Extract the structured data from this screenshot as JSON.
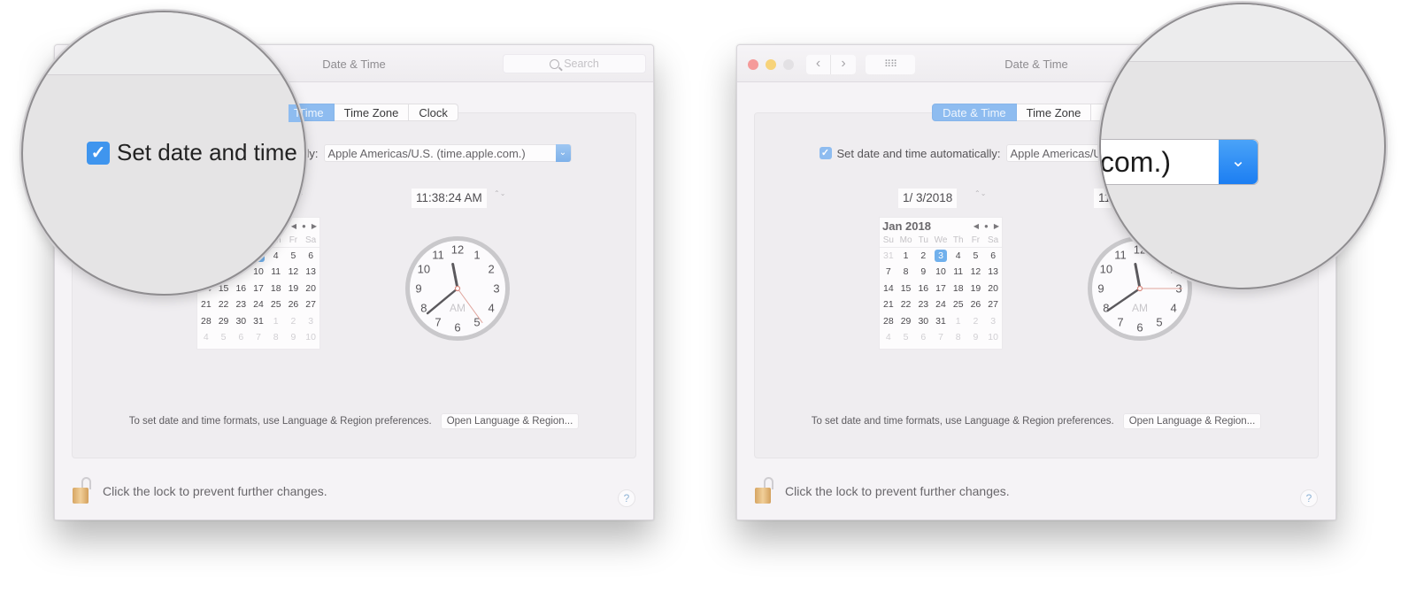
{
  "window": {
    "title": "Date & Time",
    "search_placeholder": "Search",
    "nav_back": "‹",
    "nav_forward": "›",
    "grid_icon": "⠿⠿"
  },
  "tabs": [
    {
      "label": "Date & Time",
      "active": true
    },
    {
      "label": "Time Zone",
      "active": false
    },
    {
      "label": "Clock",
      "active": false
    }
  ],
  "auto_time": {
    "checked": true,
    "check_glyph": "✓",
    "label": "Set date and time automatically:",
    "server": "Apple Americas/U.S. (time.apple.com.)",
    "arrow_glyph": "⌄"
  },
  "date_field": {
    "value": "1/  3/2018",
    "stepper": "⌃⌄"
  },
  "time_field": {
    "value": "11:38:24 AM"
  },
  "calendar": {
    "month_label": "Jan 2018",
    "nav_prev": "◀",
    "nav_today": "●",
    "nav_next": "▶",
    "weekdays": [
      "Su",
      "Mo",
      "Tu",
      "We",
      "Th",
      "Fr",
      "Sa"
    ],
    "selected_day": 3,
    "days": [
      {
        "d": "31",
        "other": true
      },
      {
        "d": "1"
      },
      {
        "d": "2"
      },
      {
        "d": "3",
        "sel": true
      },
      {
        "d": "4"
      },
      {
        "d": "5"
      },
      {
        "d": "6"
      },
      {
        "d": "7"
      },
      {
        "d": "8"
      },
      {
        "d": "9"
      },
      {
        "d": "10"
      },
      {
        "d": "11"
      },
      {
        "d": "12"
      },
      {
        "d": "13"
      },
      {
        "d": "14"
      },
      {
        "d": "15"
      },
      {
        "d": "16"
      },
      {
        "d": "17"
      },
      {
        "d": "18"
      },
      {
        "d": "19"
      },
      {
        "d": "20"
      },
      {
        "d": "21"
      },
      {
        "d": "22"
      },
      {
        "d": "23"
      },
      {
        "d": "24"
      },
      {
        "d": "25"
      },
      {
        "d": "26"
      },
      {
        "d": "27"
      },
      {
        "d": "28"
      },
      {
        "d": "29"
      },
      {
        "d": "30"
      },
      {
        "d": "31"
      },
      {
        "d": "1",
        "other": true
      },
      {
        "d": "2",
        "other": true
      },
      {
        "d": "3",
        "other": true
      },
      {
        "d": "4",
        "other": true
      },
      {
        "d": "5",
        "other": true
      },
      {
        "d": "6",
        "other": true
      },
      {
        "d": "7",
        "other": true
      },
      {
        "d": "8",
        "other": true
      },
      {
        "d": "9",
        "other": true
      },
      {
        "d": "10",
        "other": true
      }
    ]
  },
  "clock": {
    "numerals": [
      "12",
      "1",
      "2",
      "3",
      "4",
      "5",
      "6",
      "7",
      "8",
      "9",
      "10",
      "11"
    ],
    "meridiem": "AM",
    "left": {
      "hour": 11,
      "minute": 38,
      "second": 24
    },
    "right": {
      "hour": 11,
      "minute": 39,
      "second": 15
    }
  },
  "formats": {
    "text": "To set date and time formats, use Language & Region preferences.",
    "button": "Open Language & Region..."
  },
  "lock": {
    "text": "Click the lock to prevent further changes."
  },
  "help": {
    "label": "?"
  },
  "magnifier_left": {
    "check_glyph": "✓",
    "text": "Set date and time",
    "tab_fragment": "Time",
    "label_fragment": "y:"
  },
  "magnifier_right": {
    "value_fragment": "com.)",
    "arrow_glyph": "⌄"
  },
  "colors": {
    "accent": "#8ebcf0",
    "accent_strong": "#3f95ee",
    "lock": "#e0b574"
  }
}
